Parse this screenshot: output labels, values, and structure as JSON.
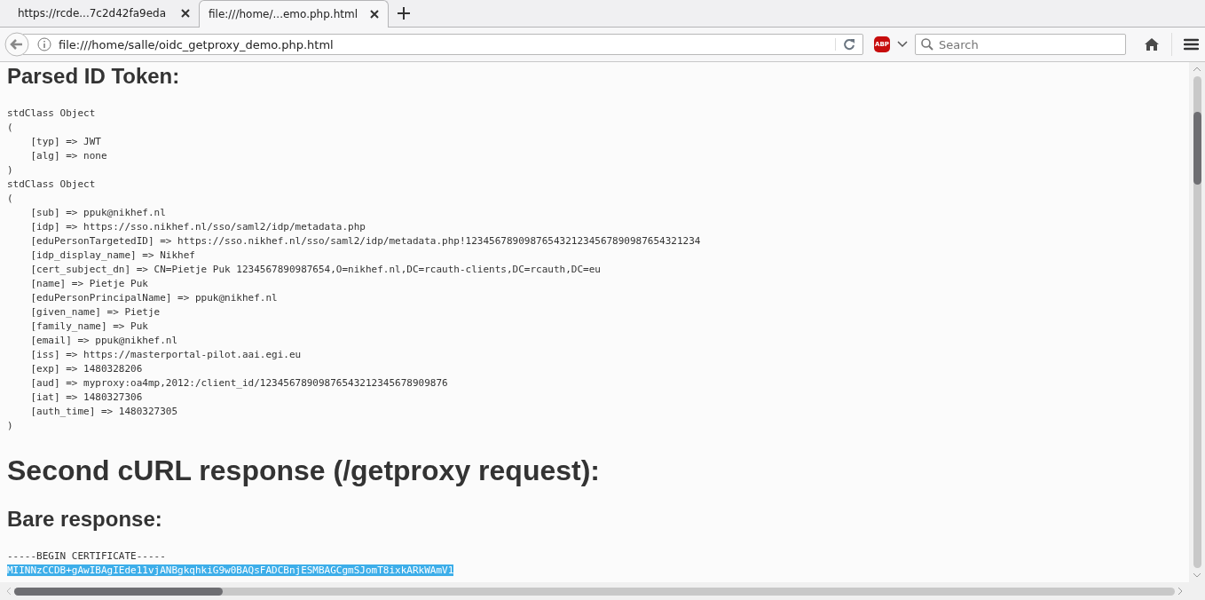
{
  "tabs": [
    {
      "title": "https://rcde...7c2d42fa9eda",
      "selected": false
    },
    {
      "title": "file:///home/...emo.php.html",
      "selected": true
    }
  ],
  "toolbar": {
    "url": "file:///home/salle/oidc_getproxy_demo.php.html",
    "search": {
      "placeholder": "Search"
    },
    "adblock_label": "ABP"
  },
  "content": [
    {
      "kind": "subheading",
      "text": "Parsed ID Token:"
    },
    {
      "kind": "pre",
      "lines": [
        {
          "text": "stdClass Object",
          "selected": false
        },
        {
          "text": "(",
          "selected": false
        },
        {
          "text": "    [typ] => JWT",
          "selected": false
        },
        {
          "text": "    [alg] => none",
          "selected": false
        },
        {
          "text": ")",
          "selected": false
        },
        {
          "text": "stdClass Object",
          "selected": false
        },
        {
          "text": "(",
          "selected": false
        },
        {
          "text": "    [sub] => ppuk@nikhef.nl",
          "selected": false
        },
        {
          "text": "    [idp] => https://sso.nikhef.nl/sso/saml2/idp/metadata.php",
          "selected": false
        },
        {
          "text": "    [eduPersonTargetedID] => https://sso.nikhef.nl/sso/saml2/idp/metadata.php!1234567890987654321234567890987654321234",
          "selected": false
        },
        {
          "text": "    [idp_display_name] => Nikhef",
          "selected": false
        },
        {
          "text": "    [cert_subject_dn] => CN=Pietje Puk 1234567890987654,O=nikhef.nl,DC=rcauth-clients,DC=rcauth,DC=eu",
          "selected": false
        },
        {
          "text": "    [name] => Pietje Puk",
          "selected": false
        },
        {
          "text": "    [eduPersonPrincipalName] => ppuk@nikhef.nl",
          "selected": false
        },
        {
          "text": "    [given_name] => Pietje",
          "selected": false
        },
        {
          "text": "    [family_name] => Puk",
          "selected": false
        },
        {
          "text": "    [email] => ppuk@nikhef.nl",
          "selected": false
        },
        {
          "text": "    [iss] => https://masterportal-pilot.aai.egi.eu",
          "selected": false
        },
        {
          "text": "    [exp] => 1480328206",
          "selected": false
        },
        {
          "text": "    [aud] => myproxy:oa4mp,2012:/client_id/12345678909876543212345678909876",
          "selected": false
        },
        {
          "text": "    [iat] => 1480327306",
          "selected": false
        },
        {
          "text": "    [auth_time] => 1480327305",
          "selected": false
        },
        {
          "text": ")",
          "selected": false
        }
      ]
    },
    {
      "kind": "heading",
      "text": "Second cURL response (/getproxy request):"
    },
    {
      "kind": "subheading",
      "text": "Bare response:"
    },
    {
      "kind": "pre",
      "lines": [
        {
          "text": "-----BEGIN CERTIFICATE-----",
          "selected": false
        },
        {
          "text": "MIINNzCCDB+gAwIBAgIEde11vjANBgkqhkiG9w0BAQsFADCBnjESMBAGCgmSJomT8ixkARkWAmV1",
          "selected": true
        }
      ]
    }
  ]
}
